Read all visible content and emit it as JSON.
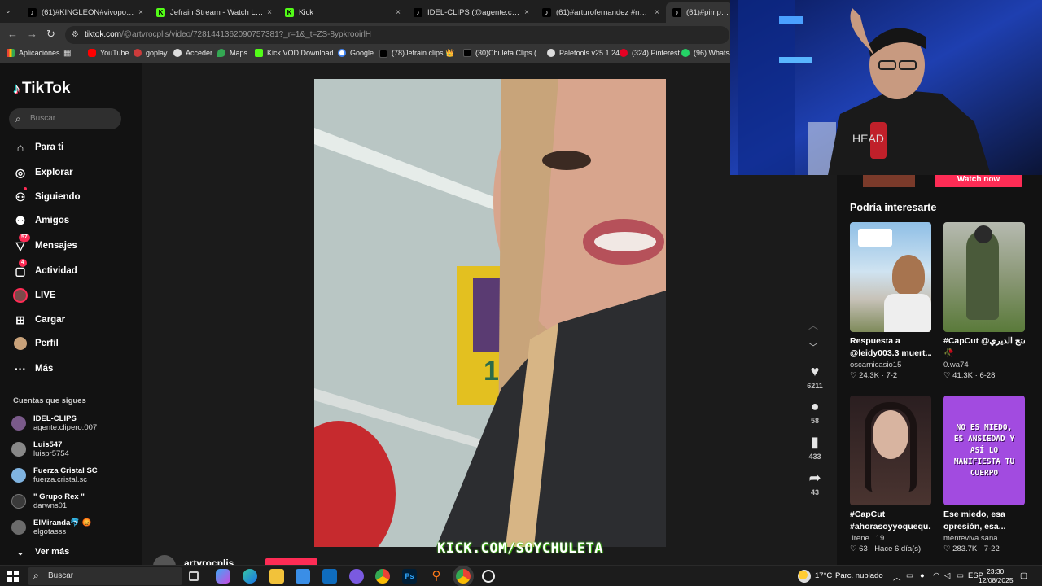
{
  "browser": {
    "tabs": [
      {
        "title": "(61)#KINGLEON#vivoporelstrea",
        "icon": "tiktok-icon",
        "close": "×"
      },
      {
        "title": "Jefrain Stream - Watch Live on",
        "icon": "kick-icon",
        "close": "×"
      },
      {
        "title": "Kick",
        "icon": "kick-icon",
        "close": "×"
      },
      {
        "title": "IDEL-CLIPS (@agente.clipero.00",
        "icon": "tiktok-icon",
        "close": "×"
      },
      {
        "title": "(61)#arturofernandez #neutroy",
        "icon": "tiktok-icon",
        "close": "×"
      },
      {
        "title": "(61)#pimpon #",
        "icon": "tiktok-icon",
        "close": ""
      }
    ],
    "url_host": "tiktok.com",
    "url_rest": "/@artvrocplis/video/7281441362090757381?_r=1&_t=ZS-8ypkrooirlH",
    "bookmarks": [
      {
        "label": "Aplicaciones",
        "icon": "apps-grid-icon"
      },
      {
        "label": "YouTube",
        "icon": "youtube-icon"
      },
      {
        "label": "goplay",
        "icon": "page-icon"
      },
      {
        "label": "Acceder",
        "icon": "page-icon"
      },
      {
        "label": "Maps",
        "icon": "maps-icon"
      },
      {
        "label": "Kick VOD Download...",
        "icon": "kick-icon"
      },
      {
        "label": "Google",
        "icon": "google-icon"
      },
      {
        "label": "(78)Jefrain clips 👑...",
        "icon": "tiktok-icon"
      },
      {
        "label": "(30)Chuleta Clips (...",
        "icon": "tiktok-icon"
      },
      {
        "label": "Paletools v25.1.24",
        "icon": "page-icon"
      },
      {
        "label": "(324) Pinterest",
        "icon": "pinterest-icon"
      },
      {
        "label": "(96) WhatsAp",
        "icon": "whatsapp-icon"
      }
    ]
  },
  "tiktok": {
    "logo": "TikTok",
    "search_placeholder": "Buscar",
    "nav": [
      {
        "label": "Para ti",
        "icon": "home-icon",
        "badge": ""
      },
      {
        "label": "Explorar",
        "icon": "compass-icon",
        "badge": ""
      },
      {
        "label": "Siguiendo",
        "icon": "following-icon",
        "badge": ""
      },
      {
        "label": "Amigos",
        "icon": "friends-icon",
        "badge": ""
      },
      {
        "label": "Mensajes",
        "icon": "inbox-icon",
        "badge": "57"
      },
      {
        "label": "Actividad",
        "icon": "activity-icon",
        "badge": "4"
      },
      {
        "label": "LIVE",
        "icon": "live-icon",
        "badge": ""
      },
      {
        "label": "Cargar",
        "icon": "upload-icon",
        "badge": ""
      },
      {
        "label": "Perfil",
        "icon": "profile-icon",
        "badge": ""
      },
      {
        "label": "Más",
        "icon": "more-icon",
        "badge": ""
      }
    ],
    "following_title": "Cuentas que sigues",
    "following": [
      {
        "name": "IDEL-CLIPS",
        "handle": "agente.clipero.007",
        "color": "#7a5a8a"
      },
      {
        "name": "Luis547",
        "handle": "luispr5754",
        "color": "#888888"
      },
      {
        "name": "Fuerza Cristal SC",
        "handle": "fuerza.cristal.sc",
        "color": "#7fb3e0"
      },
      {
        "name": "\" Grupo Rex \"",
        "handle": "darwns01",
        "color": "#3a3a3a"
      },
      {
        "name": "ElMiranda🐬 😡",
        "handle": "elgotasss",
        "color": "#6b6b6b"
      }
    ],
    "see_more": "Ver más",
    "video": {
      "author": "artvrocplis",
      "overlay": "KICK.COM/SOYCHULETA",
      "likes": "6211",
      "comments": "58",
      "saves": "433",
      "shares": "43"
    },
    "watch_now": "Watch now",
    "suggest_title": "Podría interesarte",
    "suggestions": [
      {
        "title": "Respuesta a",
        "title2": "@leidy003.3 muert...",
        "user": "oscarnicasio15",
        "views": "24.3K",
        "date": "7-2"
      },
      {
        "title": "#CapCut @المفتح الديري",
        "title2": "🥀",
        "user": "0.wa74",
        "views": "41.3K",
        "date": "6-28"
      },
      {
        "title": "#CapCut",
        "title2": "#ahorasoyyoquequ...",
        "user": ".irene...19",
        "views": "63",
        "date": "Hace 6 día(s)"
      },
      {
        "title": "Ese miedo, esa",
        "title2": "opresión, esa...",
        "user": "menteviva.sana",
        "views": "283.7K",
        "date": "7-22"
      }
    ],
    "purple_thumb_text": "NO ES MIEDO, ES ANSIEDAD Y ASÍ LO MANIFIESTA TU CUERPO"
  },
  "taskbar": {
    "search_placeholder": "Buscar",
    "weather": "17°C",
    "weather_desc": "Parc. nublado",
    "lang": "ESP",
    "time": "23:30",
    "date": "12/08/2025"
  },
  "colors": {
    "tiktok_red": "#fe2c55",
    "kick_green": "#53fc18",
    "purple_thumb": "#a24be0"
  }
}
